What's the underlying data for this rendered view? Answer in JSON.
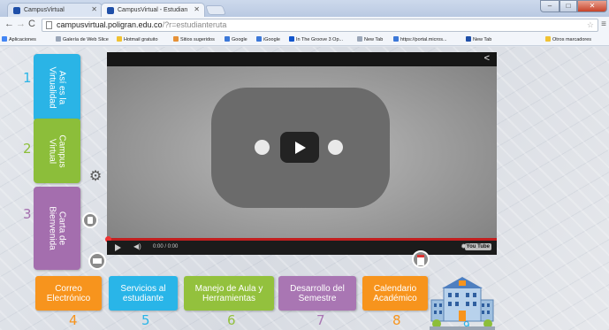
{
  "browser": {
    "tabs": [
      {
        "label": "CampusVirtual",
        "active": false
      },
      {
        "label": "CampusVirtual - Estudian",
        "active": true
      }
    ],
    "url_domain": "campusvirtual.poligran.edu.co",
    "url_path": "/?r=estudianteruta",
    "bookmarks": [
      {
        "label": "Aplicaciones",
        "color": "#4285f4"
      },
      {
        "label": "Galería de Web Slice",
        "color": "#9aa6b8"
      },
      {
        "label": "Hotmail gratuito",
        "color": "#f1c232"
      },
      {
        "label": "Sitios sugeridos",
        "color": "#e69138"
      },
      {
        "label": "Google",
        "color": "#3c78d8"
      },
      {
        "label": "iGoogle",
        "color": "#3c78d8"
      },
      {
        "label": "In The Groove 3 Op...",
        "color": "#1155cc"
      },
      {
        "label": "New Tab",
        "color": "#9aa6b8"
      },
      {
        "label": "https://portal.micros...",
        "color": "#3c78d8"
      },
      {
        "label": "New Tab",
        "color": "#1f4fa8"
      },
      {
        "label": "Otros marcadores",
        "color": "#f1c232"
      }
    ]
  },
  "video": {
    "time": "0:00 / 0:00",
    "youtube_label": "You Tube"
  },
  "side_menu": [
    {
      "num": "1",
      "label": "Así es la\nVirtualidad",
      "num_color": "#2ab4e6"
    },
    {
      "num": "2",
      "label": "Campus\nVirtual",
      "num_color": "#8cbe3a"
    },
    {
      "num": "3",
      "label": "Carta de\nBienvenida",
      "num_color": "#a46eae"
    }
  ],
  "bottom_menu": [
    {
      "num": "4",
      "label": "Correo\nElectrónico",
      "num_color": "#f7941d"
    },
    {
      "num": "5",
      "label": "Servicios al\nestudiante",
      "num_color": "#29b5e8"
    },
    {
      "num": "6",
      "label": "Manejo de Aula y\nHerramientas",
      "num_color": "#93c13d"
    },
    {
      "num": "7",
      "label": "Desarrollo del\nSemestre",
      "num_color": "#a976b3"
    },
    {
      "num": "8",
      "label": "Calendario\nAcadémico",
      "num_color": "#f7941d"
    },
    {
      "num": "9",
      "label": "",
      "num_color": "#29b5e8"
    }
  ]
}
